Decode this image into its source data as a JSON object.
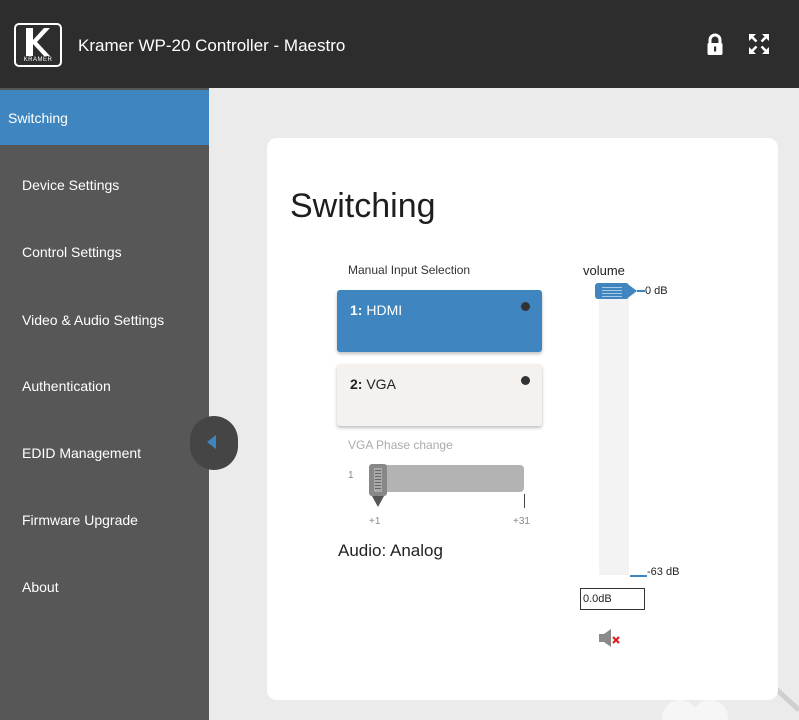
{
  "header": {
    "title": "Kramer WP-20 Controller - Maestro",
    "logo_text": "KRAMER",
    "icons": [
      "lock-icon",
      "fullscreen-icon"
    ]
  },
  "sidebar": {
    "items": [
      {
        "label": "Switching",
        "active": true
      },
      {
        "label": "Device Settings"
      },
      {
        "label": "Control Settings"
      },
      {
        "label": "Video & Audio Settings"
      },
      {
        "label": "Authentication"
      },
      {
        "label": "EDID Management"
      },
      {
        "label": "Firmware Upgrade"
      },
      {
        "label": "About"
      }
    ]
  },
  "main": {
    "title": "Switching",
    "manual_input_label": "Manual Input Selection",
    "inputs": [
      {
        "number": "1:",
        "name": "HDMI",
        "selected": true
      },
      {
        "number": "2:",
        "name": "VGA",
        "selected": false
      }
    ],
    "vga_phase": {
      "label": "VGA Phase change",
      "current_value": "1",
      "min_label": "+1",
      "max_label": "+31",
      "min": 1,
      "max": 31,
      "value": 1
    },
    "audio_label": "Audio: Analog",
    "volume": {
      "label": "volume",
      "top_label": "0 dB",
      "bottom_label": "-63 dB",
      "value": "0.0dB"
    }
  },
  "colors": {
    "header_bg": "#2d2d2d",
    "sidebar_bg": "#575757",
    "accent": "#3f85c0",
    "content_bg": "#ebebeb"
  }
}
